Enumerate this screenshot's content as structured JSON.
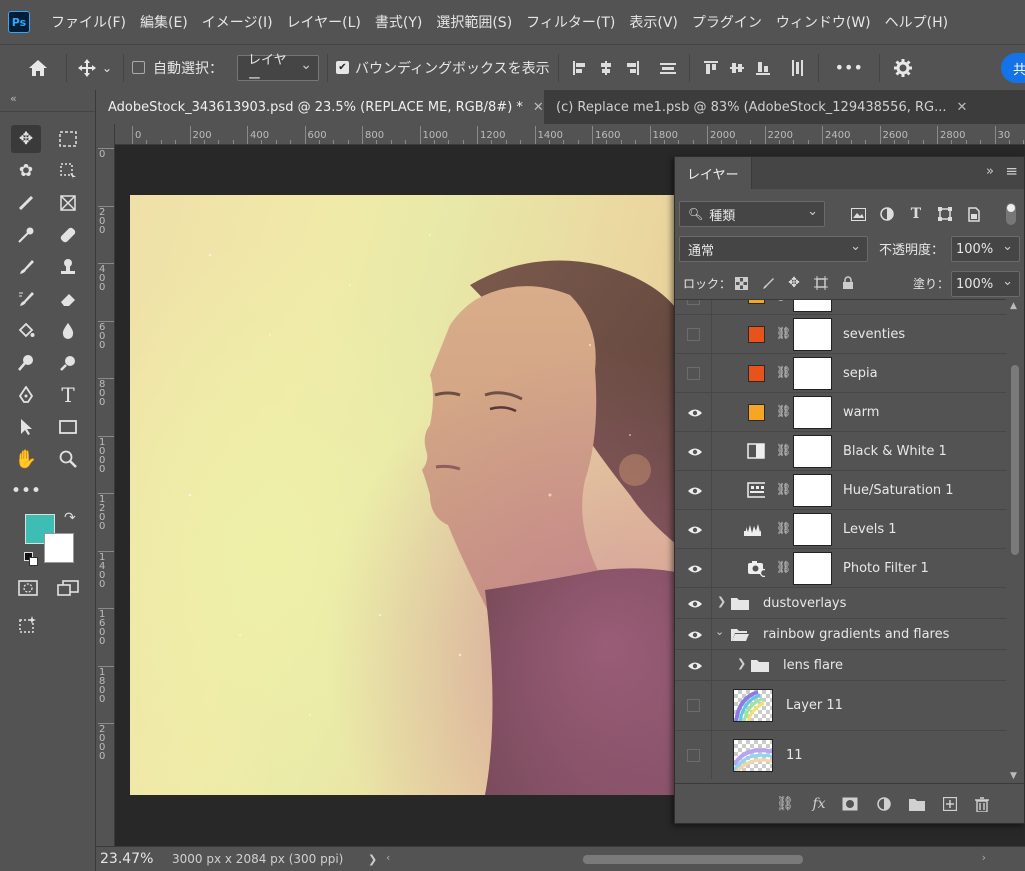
{
  "app": {
    "logo_text": "Ps"
  },
  "menu": [
    "ファイル(F)",
    "編集(E)",
    "イメージ(I)",
    "レイヤー(L)",
    "書式(Y)",
    "選択範囲(S)",
    "フィルター(T)",
    "表示(V)",
    "プラグイン",
    "ウィンドウ(W)",
    "ヘルプ(H)"
  ],
  "options": {
    "auto_select_label": "自動選択：",
    "auto_select_checked": false,
    "auto_select_target": "レイヤー",
    "bounding_box_label": "バウンディングボックスを表示",
    "bounding_box_checked": true,
    "more_label": "•••",
    "share_label": "共"
  },
  "toolpanel": {
    "collapse_label": "«"
  },
  "tabs": [
    {
      "label": "AdobeStock_343613903.psd @ 23.5% (REPLACE ME, RGB/8#) *",
      "active": true
    },
    {
      "label": "(c) Replace me1.psb @ 83% (AdobeStock_129438556, RG...",
      "active": false
    }
  ],
  "ruler": {
    "h_ticks": [
      "0",
      "200",
      "400",
      "600",
      "800",
      "1000",
      "1200",
      "1400",
      "1600",
      "1800",
      "2000",
      "2200",
      "2400",
      "2600",
      "2800",
      "30"
    ],
    "v_ticks": [
      "0",
      "200",
      "400",
      "600",
      "800",
      "1000",
      "1200",
      "1400",
      "1600",
      "1800",
      "2000"
    ]
  },
  "status": {
    "zoom": "23.47%",
    "doc_size": "3000 px x 2084 px (300 ppi)",
    "arrow": "❯"
  },
  "layers_panel": {
    "tab_label": "レイヤー",
    "collapse_label": "»",
    "filter_label": "種類",
    "blend_mode": "通常",
    "opacity_label": "不透明度：",
    "opacity_value": "100%",
    "lock_label": "ロック：",
    "fill_label": "塗り：",
    "fill_value": "100%",
    "layers": [
      {
        "name": "",
        "visible": false,
        "kind": "swatch",
        "color": "#f5a623",
        "partial": true
      },
      {
        "name": "seventies",
        "visible": false,
        "kind": "swatch",
        "color": "#e8531c"
      },
      {
        "name": "sepia",
        "visible": false,
        "kind": "swatch",
        "color": "#e8531c"
      },
      {
        "name": "warm",
        "visible": true,
        "kind": "swatch",
        "color": "#f5a623"
      },
      {
        "name": "Black & White 1",
        "visible": true,
        "kind": "bw-icon"
      },
      {
        "name": "Hue/Saturation 1",
        "visible": true,
        "kind": "huesat-icon"
      },
      {
        "name": "Levels 1",
        "visible": true,
        "kind": "levels-icon"
      },
      {
        "name": "Photo Filter 1",
        "visible": true,
        "kind": "photofilter-icon"
      },
      {
        "name": "dustoverlays",
        "visible": true,
        "kind": "group",
        "expanded": false
      },
      {
        "name": "rainbow gradients and flares",
        "visible": true,
        "kind": "group",
        "expanded": true
      },
      {
        "name": "lens flare",
        "visible": true,
        "kind": "subgroup",
        "expanded": false
      },
      {
        "name": "Layer 11",
        "visible": false,
        "kind": "pixel"
      },
      {
        "name": "11",
        "visible": false,
        "kind": "pixel"
      }
    ]
  }
}
